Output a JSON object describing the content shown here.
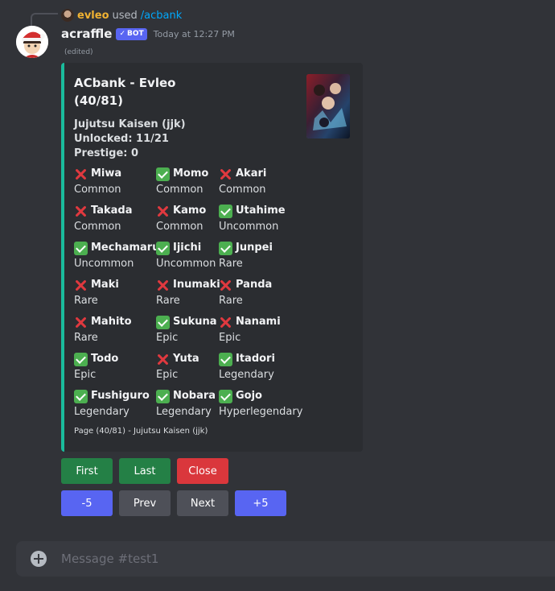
{
  "reply": {
    "user": "evleo",
    "action": "used",
    "command": "/acbank"
  },
  "message": {
    "author": "acraffle",
    "badge": "BOT",
    "timestamp": "Today at 12:27 PM",
    "edited": "(edited)"
  },
  "embed": {
    "accent_color": "#1abc9c",
    "title_line1": "ACbank - Evleo",
    "title_line2": "(40/81)",
    "series": "Jujutsu Kaisen (jjk)",
    "unlocked": "Unlocked: 11/21",
    "prestige": "Prestige: 0",
    "fields": [
      {
        "name": "Miwa",
        "rarity": "Common",
        "owned": false
      },
      {
        "name": "Momo",
        "rarity": "Common",
        "owned": true
      },
      {
        "name": "Akari",
        "rarity": "Common",
        "owned": false
      },
      {
        "name": "Takada",
        "rarity": "Common",
        "owned": false
      },
      {
        "name": "Kamo",
        "rarity": "Common",
        "owned": false
      },
      {
        "name": "Utahime",
        "rarity": "Uncommon",
        "owned": true
      },
      {
        "name": "Mechamaru",
        "rarity": "Uncommon",
        "owned": true
      },
      {
        "name": "Ijichi",
        "rarity": "Uncommon",
        "owned": true
      },
      {
        "name": "Junpei",
        "rarity": "Rare",
        "owned": true
      },
      {
        "name": "Maki",
        "rarity": "Rare",
        "owned": false
      },
      {
        "name": "Inumaki",
        "rarity": "Rare",
        "owned": false
      },
      {
        "name": "Panda",
        "rarity": "Rare",
        "owned": false
      },
      {
        "name": "Mahito",
        "rarity": "Rare",
        "owned": false
      },
      {
        "name": "Sukuna",
        "rarity": "Epic",
        "owned": true
      },
      {
        "name": "Nanami",
        "rarity": "Epic",
        "owned": false
      },
      {
        "name": "Todo",
        "rarity": "Epic",
        "owned": true
      },
      {
        "name": "Yuta",
        "rarity": "Epic",
        "owned": false
      },
      {
        "name": "Itadori",
        "rarity": "Legendary",
        "owned": true
      },
      {
        "name": "Fushiguro",
        "rarity": "Legendary",
        "owned": true
      },
      {
        "name": "Nobara",
        "rarity": "Legendary",
        "owned": true
      },
      {
        "name": "Gojo",
        "rarity": "Hyperlegendary",
        "owned": true
      }
    ],
    "footer": "Page (40/81) - Jujutsu Kaisen (jjk)"
  },
  "buttons": {
    "row1": [
      {
        "label": "First",
        "style": "green"
      },
      {
        "label": "Last",
        "style": "green"
      },
      {
        "label": "Close",
        "style": "red"
      }
    ],
    "row2": [
      {
        "label": "-5",
        "style": "blurple"
      },
      {
        "label": "Prev",
        "style": "grey"
      },
      {
        "label": "Next",
        "style": "grey"
      },
      {
        "label": "+5",
        "style": "blurple"
      }
    ]
  },
  "input": {
    "placeholder": "Message #test1"
  }
}
